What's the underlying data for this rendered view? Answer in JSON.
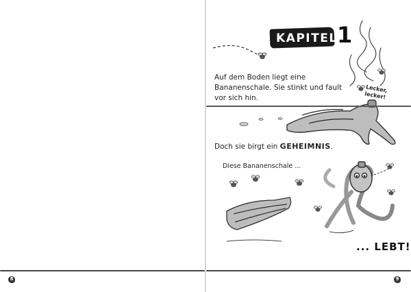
{
  "left_page": {
    "page_number": "8"
  },
  "right_page": {
    "page_number": "9",
    "chapter": {
      "label": "KAPITEL",
      "number": "1"
    },
    "paragraph_1": "Auf dem Boden liegt eine Bananenschale. Sie stinkt und fault vor sich hin.",
    "speech_line_1": "Lecker,",
    "speech_line_2": "lecker!",
    "paragraph_2_before": "Doch sie birgt ein ",
    "paragraph_2_emphasis": "GEHEIMNIS",
    "paragraph_2_after": ".",
    "panel_1_caption": "Diese Bananenschale ...",
    "panel_2_caption": "... LEBT!"
  }
}
